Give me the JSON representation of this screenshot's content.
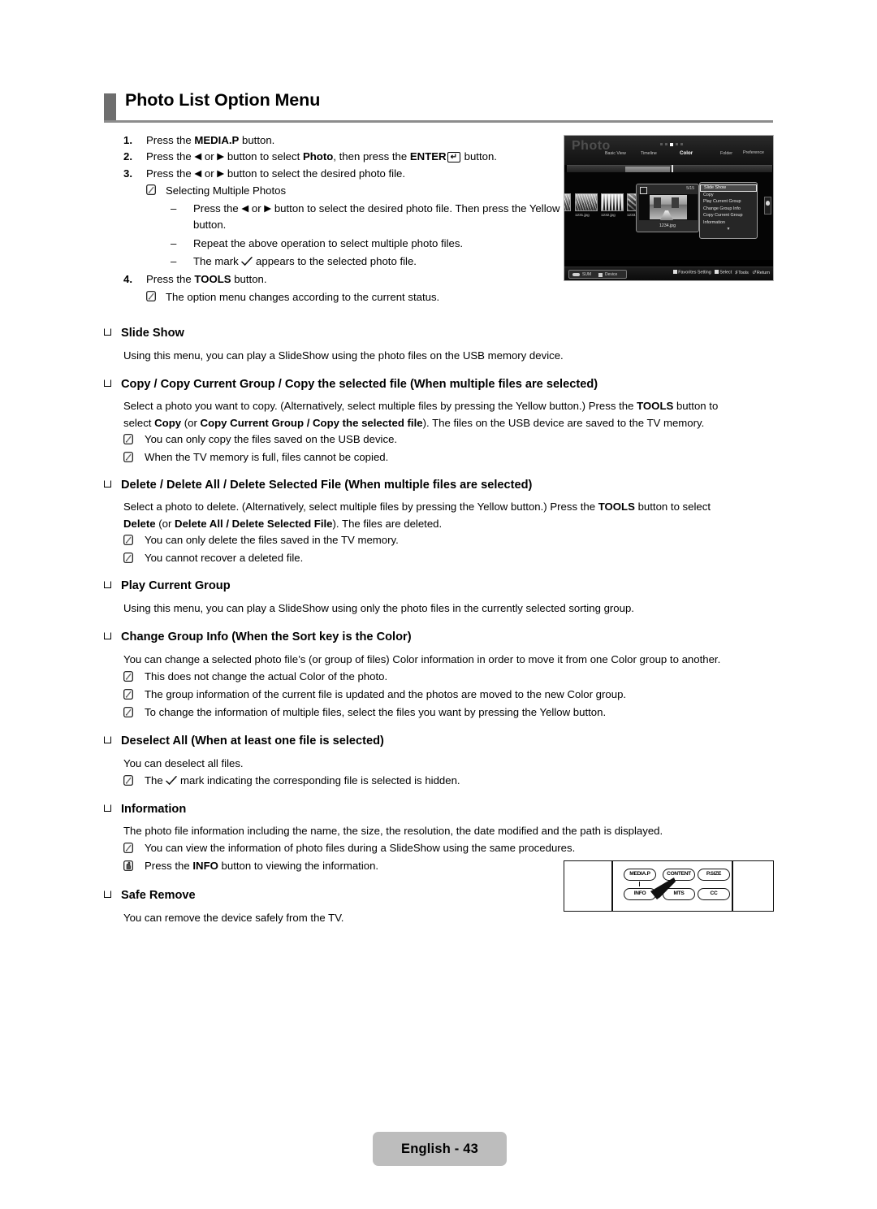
{
  "header": {
    "title": "Photo List Option Menu"
  },
  "steps": [
    {
      "num": "1.",
      "parts": [
        {
          "t": "Press the ",
          "b": false
        },
        {
          "t": "MEDIA.P",
          "b": true
        },
        {
          "t": " button.",
          "b": false
        }
      ]
    },
    {
      "num": "2.",
      "parts": [
        {
          "t": "Press the ",
          "b": false
        },
        {
          "t": "◀",
          "b": false,
          "glyph": true
        },
        {
          "t": " or ",
          "b": false
        },
        {
          "t": "▶",
          "b": false,
          "glyph": true
        },
        {
          "t": " button to select ",
          "b": false
        },
        {
          "t": "Photo",
          "b": true
        },
        {
          "t": ", then press the ",
          "b": false
        },
        {
          "t": "ENTER",
          "b": true
        },
        {
          "t": "ENTERKEY",
          "b": false,
          "key": true
        },
        {
          "t": " button.",
          "b": false
        }
      ]
    },
    {
      "num": "3.",
      "parts": [
        {
          "t": "Press the ",
          "b": false
        },
        {
          "t": "◀",
          "b": false,
          "glyph": true
        },
        {
          "t": " or ",
          "b": false
        },
        {
          "t": "▶",
          "b": false,
          "glyph": true
        },
        {
          "t": " button to select the desired photo file.",
          "b": false
        }
      ]
    }
  ],
  "step3_note": "Selecting Multiple Photos",
  "step3_dashes": [
    {
      "parts": [
        {
          "t": "Press the ",
          "b": false
        },
        {
          "t": "◀",
          "b": false,
          "glyph": true
        },
        {
          "t": " or ",
          "b": false
        },
        {
          "t": "▶",
          "b": false,
          "glyph": true
        },
        {
          "t": " button to select the desired photo file. Then press the Yellow button.",
          "b": false
        }
      ]
    },
    {
      "parts": [
        {
          "t": "Repeat the above operation to select multiple photo files.",
          "b": false
        }
      ]
    },
    {
      "parts": [
        {
          "t": "The mark ",
          "b": false
        },
        {
          "t": "CHECKMARK",
          "b": false,
          "check": true
        },
        {
          "t": " appears to the selected photo file.",
          "b": false
        }
      ]
    }
  ],
  "step4": {
    "num": "4.",
    "parts": [
      {
        "t": "Press the ",
        "b": false
      },
      {
        "t": "TOOLS",
        "b": true
      },
      {
        "t": " button.",
        "b": false
      }
    ]
  },
  "step4_note": "The option menu changes according to the current status.",
  "sections": [
    {
      "id": "slide-show",
      "heading": "Slide Show",
      "body": [
        [
          {
            "t": "Using this menu, you can play a SlideShow using the photo files on the USB memory device.",
            "b": false
          }
        ]
      ],
      "notes": []
    },
    {
      "id": "copy",
      "heading": "Copy / Copy Current Group / Copy the selected file (When multiple files are selected)",
      "body": [
        [
          {
            "t": "Select a photo you want to copy. (Alternatively, select multiple files by pressing the Yellow button.) Press the ",
            "b": false
          },
          {
            "t": "TOOLS",
            "b": true
          },
          {
            "t": " button to",
            "b": false
          }
        ],
        [
          {
            "t": "select ",
            "b": false
          },
          {
            "t": "Copy",
            "b": true
          },
          {
            "t": " (or ",
            "b": false
          },
          {
            "t": "Copy Current Group / Copy the selected file",
            "b": true
          },
          {
            "t": "). The files on the USB device are saved to the TV memory.",
            "b": false
          }
        ]
      ],
      "notes": [
        "You can only copy the files saved on the USB device.",
        "When the TV memory is full, files cannot be copied."
      ]
    },
    {
      "id": "delete",
      "heading": "Delete / Delete All / Delete Selected File (When multiple files are selected)",
      "body": [
        [
          {
            "t": "Select a photo to delete. (Alternatively, select multiple files by pressing the Yellow button.) Press the ",
            "b": false
          },
          {
            "t": "TOOLS",
            "b": true
          },
          {
            "t": " button to select",
            "b": false
          }
        ],
        [
          {
            "t": "Delete",
            "b": true
          },
          {
            "t": " (or ",
            "b": false
          },
          {
            "t": "Delete All / Delete Selected File",
            "b": true
          },
          {
            "t": "). The files are deleted.",
            "b": false
          }
        ]
      ],
      "notes": [
        "You can only delete the files saved in the TV memory.",
        "You cannot recover a deleted file."
      ]
    },
    {
      "id": "play-current-group",
      "heading": "Play Current Group",
      "body": [
        [
          {
            "t": "Using this menu, you can play a SlideShow using only the photo files in the currently selected sorting group.",
            "b": false
          }
        ]
      ],
      "notes": []
    },
    {
      "id": "change-group-info",
      "heading": "Change Group Info (When the Sort key is the Color)",
      "body": [
        [
          {
            "t": "You can change a selected photo file’s (or group of files) Color information in order to move it from one Color group to another.",
            "b": false
          }
        ]
      ],
      "notes": [
        "This does not change the actual Color of the photo.",
        "The group information of the current file is updated and the photos are moved to the new Color group.",
        "To change the information of multiple files, select the files you want by pressing the Yellow button."
      ]
    },
    {
      "id": "deselect-all",
      "heading": "Deselect All (When at least one file is selected)",
      "body": [
        [
          {
            "t": "You can deselect all files.",
            "b": false
          }
        ]
      ],
      "notes_rich": [
        [
          {
            "t": "The ",
            "b": false
          },
          {
            "t": "CHECKMARK",
            "b": false,
            "check": true
          },
          {
            "t": " mark indicating the corresponding file is selected is hidden.",
            "b": false
          }
        ]
      ],
      "notes": []
    },
    {
      "id": "information",
      "heading": "Information",
      "body": [
        [
          {
            "t": "The photo file information including the name, the size, the resolution, the date modified and the path is displayed.",
            "b": false
          }
        ]
      ],
      "notes": [
        "You can view the information of photo files during a SlideShow using the same procedures."
      ],
      "hand_note": [
        {
          "t": "Press the ",
          "b": false
        },
        {
          "t": "INFO",
          "b": true
        },
        {
          "t": " button to viewing the information.",
          "b": false
        }
      ]
    },
    {
      "id": "safe-remove",
      "heading": "Safe Remove",
      "body": [
        [
          {
            "t": "You can remove the device safely from the TV.",
            "b": false
          }
        ]
      ],
      "notes": []
    }
  ],
  "tv_screen": {
    "title": "Photo",
    "nav": [
      "Basic View",
      "Timeline",
      "Color",
      "Folder",
      "Preference"
    ],
    "nav_active": "Color",
    "thumbnails": [
      {
        "label": "1231.jpg"
      },
      {
        "label": "1232.jpg"
      },
      {
        "label": "1233.jpg"
      }
    ],
    "selected_card": {
      "count": "5/15",
      "filename": "1234.jpg"
    },
    "option_menu": [
      "Slide Show",
      "Copy",
      "Play Current Group",
      "Change Group Info",
      "Copy Current Group",
      "Information"
    ],
    "option_menu_selected": "Slide Show",
    "option_menu_more": "▼",
    "source_label": "SUM",
    "device_label": "Device",
    "hints": [
      {
        "label": "Favorites Setting",
        "icon": "square"
      },
      {
        "label": "Select",
        "icon": "square"
      },
      {
        "label": "Tools",
        "icon": "tools"
      },
      {
        "label": "Return",
        "icon": "return"
      }
    ]
  },
  "remote": {
    "buttons_row1": [
      "MEDIA.P",
      "CONTENT",
      "P.SIZE"
    ],
    "buttons_row2": [
      "INFO",
      "MTS",
      "CC"
    ],
    "highlighted": "INFO"
  },
  "footer": {
    "page_label": "English - 43"
  },
  "colors": {
    "header_bar": "#6e6e6e",
    "header_rule": "#8c8c8c",
    "footer_bg": "#bdbdbd",
    "text": "#000000"
  }
}
